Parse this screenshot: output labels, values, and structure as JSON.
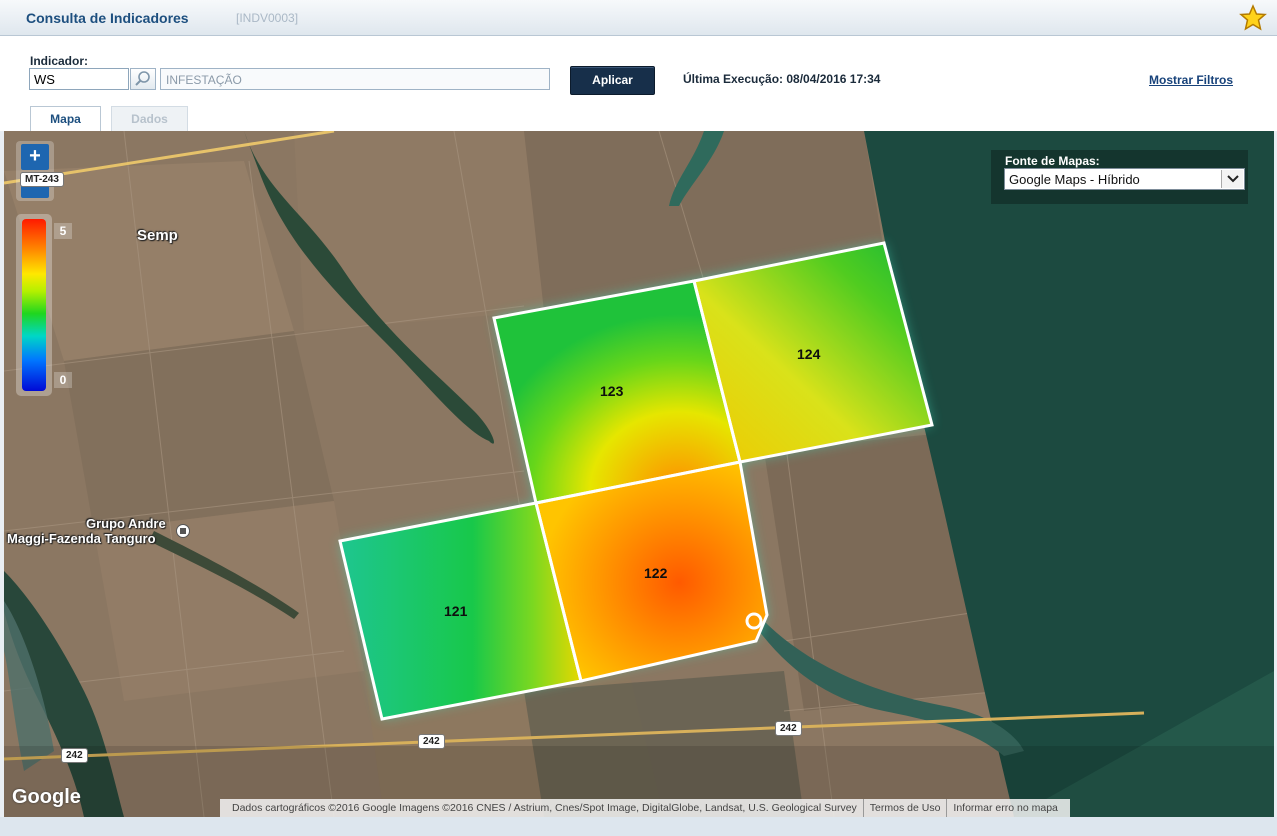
{
  "window": {
    "title": "Consulta de Indicadores",
    "code": "[INDV0003]"
  },
  "filters": {
    "indicator_label": "Indicador:",
    "indicator_code": "WS",
    "indicator_description": "INFESTAÇÃO",
    "apply_label": "Aplicar",
    "last_run": "Última Execução: 08/04/2016 17:34",
    "show_filters_label": "Mostrar Filtros"
  },
  "tabs": [
    {
      "label": "Mapa",
      "active": true
    },
    {
      "label": "Dados",
      "active": false
    }
  ],
  "map": {
    "zoom_in": "+",
    "zoom_out": "−",
    "legend": {
      "max": "5",
      "min": "0"
    },
    "source_label": "Fonte de Mapas:",
    "source_selected": "Google Maps - Híbrido",
    "places": [
      "Semp",
      "Grupo Andre",
      "Maggi-Fazenda Tanguro"
    ],
    "roads": [
      "MT-243",
      "242",
      "242",
      "242"
    ],
    "plots": [
      "123",
      "124",
      "122",
      "121"
    ],
    "google_logo": "Google",
    "attribution": "Dados cartográficos ©2016 Google Imagens ©2016 CNES / Astrium, Cnes/Spot Image, DigitalGlobe, Landsat, U.S. Geological Survey",
    "terms": "Termos de Uso",
    "report_error": "Informar erro no mapa"
  },
  "colors": {
    "title": "#1d4f7f",
    "apply_button": "#172f4a",
    "zoom_button": "#1e66b0",
    "farmland": "#8a7660",
    "forest": "#1c4a40"
  }
}
